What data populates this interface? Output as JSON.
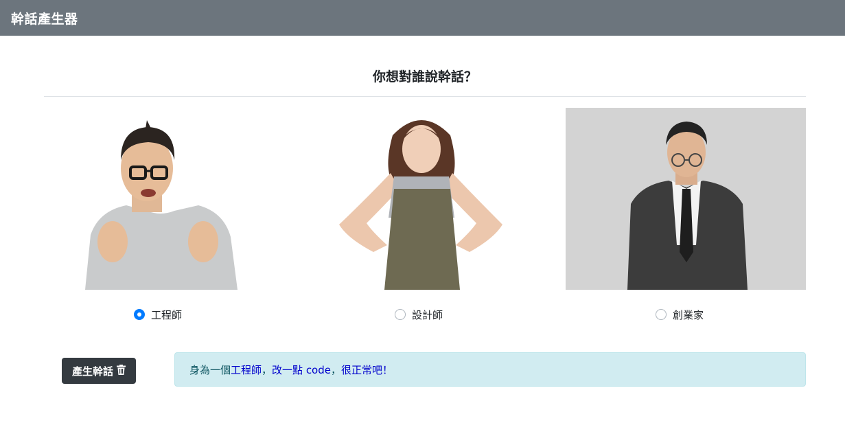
{
  "app": {
    "title": "幹話產生器"
  },
  "prompt": {
    "question": "你想對誰說幹話？"
  },
  "options": [
    {
      "label": "工程師",
      "checked": true
    },
    {
      "label": "設計師",
      "checked": false
    },
    {
      "label": "創業家",
      "checked": false
    }
  ],
  "photos": [
    {
      "subject": "工程師"
    },
    {
      "subject": "設計師"
    },
    {
      "subject": "創業家"
    }
  ],
  "generate_button": {
    "label": "產生幹話",
    "icon": "trash-icon"
  },
  "result": {
    "part1": "身為一個",
    "role": "工程師",
    "sep1": "，",
    "task": "改一點 code",
    "sep2": "，",
    "phrase": "很正常吧！"
  },
  "colors": {
    "navbar": "#6c757d",
    "accent": "#007bff",
    "button": "#343a40",
    "alert_bg": "#d1ecf1",
    "highlight": "#0000cc"
  }
}
